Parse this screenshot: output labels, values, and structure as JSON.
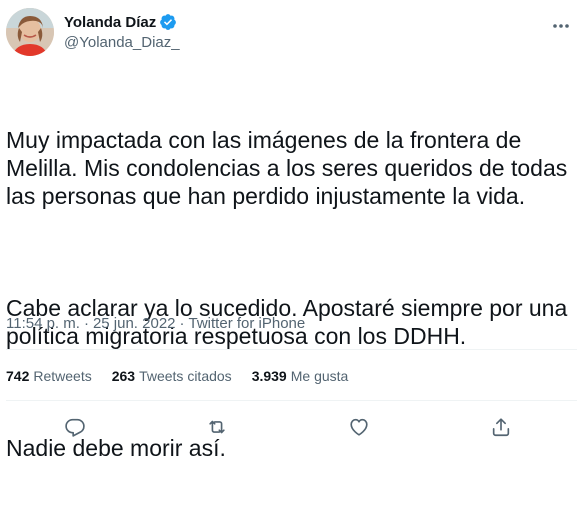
{
  "user": {
    "display_name": "Yolanda Díaz",
    "handle": "@Yolanda_Diaz_",
    "verified": true
  },
  "tweet": {
    "paragraphs": [
      "Muy impactada con las imágenes de la frontera de Melilla. Mis condolencias a los seres queridos de todas las personas que han perdido injustamente la vida.",
      "Cabe aclarar ya lo sucedido. Apostaré siempre por una política migratoria respetuosa con los DDHH.",
      "Nadie debe morir así."
    ],
    "time": "11:54 p. m.",
    "separator": "·",
    "date": "25 jun. 2022",
    "source": "Twitter for iPhone"
  },
  "stats": {
    "retweets_count": "742",
    "retweets_label": "Retweets",
    "quotes_count": "263",
    "quotes_label": "Tweets citados",
    "likes_count": "3.939",
    "likes_label": "Me gusta"
  },
  "icons": {
    "verified": "verified-badge-icon",
    "more": "more-icon",
    "reply": "reply-icon",
    "retweet": "retweet-icon",
    "like": "like-icon",
    "share": "share-icon"
  },
  "colors": {
    "text": "#0f1419",
    "secondary": "#536471",
    "verified": "#1d9bf0",
    "divider": "#eff3f4"
  }
}
